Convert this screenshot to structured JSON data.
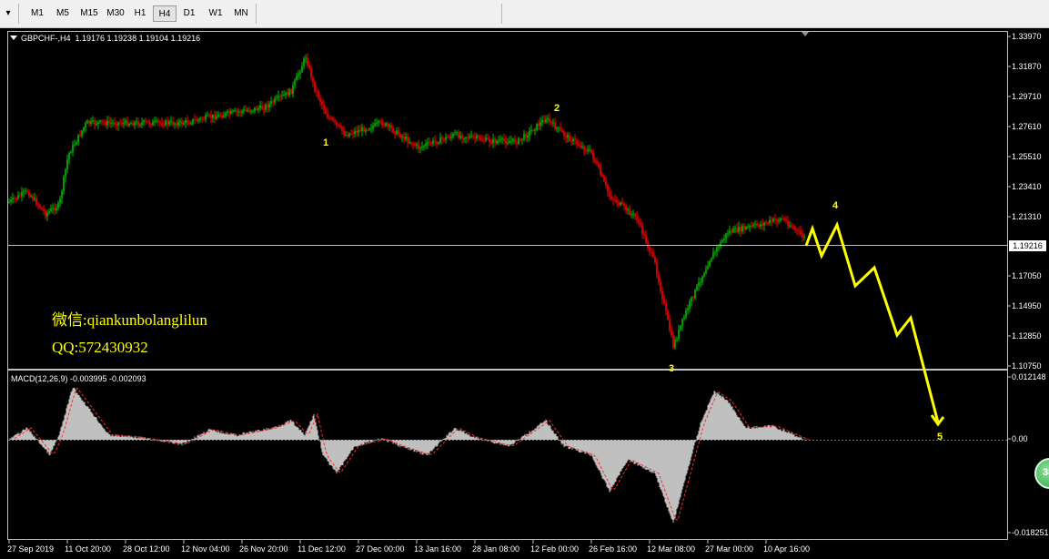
{
  "toolbar": {
    "menu_arrow": "▾",
    "timeframes": [
      "M1",
      "M5",
      "M15",
      "M30",
      "H1",
      "H4",
      "D1",
      "W1",
      "MN"
    ],
    "active": "H4"
  },
  "chart": {
    "symbol_info": "GBPCHF-,H4  1.19176 1.19238 1.19104 1.19216",
    "current_price": "1.19216",
    "price_axis": [
      "1.33970",
      "1.31870",
      "1.29710",
      "1.27610",
      "1.25510",
      "1.23410",
      "1.21310",
      "1.19216",
      "1.17050",
      "1.14950",
      "1.12850",
      "1.10750"
    ],
    "macd_info": "MACD(12,26,9) -0.003995 -0.002093",
    "macd_axis": [
      "0.012148",
      "0.00",
      "-0.018251"
    ],
    "date_axis": [
      "27 Sep 2019",
      "11 Oct 20:00",
      "28 Oct 12:00",
      "12 Nov 04:00",
      "26 Nov 20:00",
      "11 Dec 12:00",
      "27 Dec 00:00",
      "13 Jan 16:00",
      "28 Jan 08:00",
      "12 Feb 00:00",
      "26 Feb 16:00",
      "12 Mar 08:00",
      "27 Mar 00:00",
      "10 Apr 16:00"
    ],
    "wave_labels": [
      "1",
      "2",
      "3",
      "4",
      "5"
    ],
    "watermark": {
      "wechat": "微信:qiankunbolanglilun",
      "qq": "QQ:572430932"
    },
    "badge": "38"
  },
  "colors": {
    "background": "#000000",
    "bull_candle": "#00c000",
    "bear_candle": "#ff0000",
    "projection": "#ffff00",
    "macd_hist": "#c0c0c0",
    "macd_signal": "#ff0000"
  }
}
